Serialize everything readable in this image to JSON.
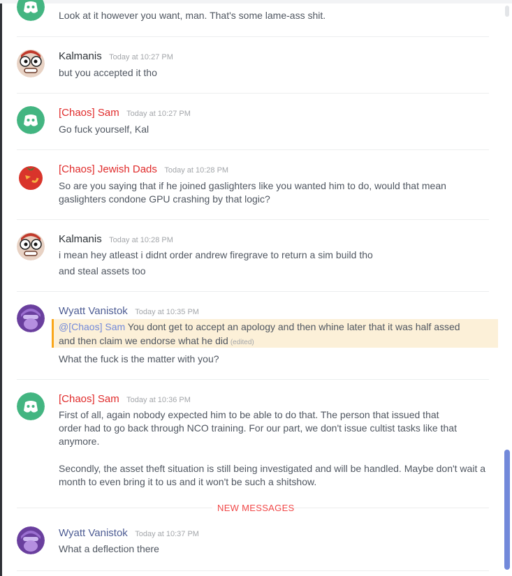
{
  "channel": {
    "messages": [
      {
        "author": "",
        "timestamp": "",
        "avatar": "discord-default-green",
        "lines": [
          "Look at it however you want, man. That's some lame-ass shit."
        ]
      },
      {
        "author": "Kalmanis",
        "timestamp": "Today at 10:27 PM",
        "avatar": "googly-eyes-face",
        "lines": [
          "but you accepted it tho"
        ]
      },
      {
        "author": "[Chaos] Sam",
        "timestamp": "Today at 10:27 PM",
        "avatar": "discord-default-green",
        "lines": [
          "Go fuck yourself, Kal"
        ]
      },
      {
        "author": "[Chaos] Jewish Dads",
        "timestamp": "Today at 10:28 PM",
        "avatar": "red-tomato-face",
        "lines": [
          "So are you saying that if he joined gaslighters like you wanted him to do, would that mean",
          "gaslighters condone GPU crashing by that logic?"
        ]
      },
      {
        "author": "Kalmanis",
        "timestamp": "Today at 10:28 PM",
        "avatar": "googly-eyes-face",
        "lines": [
          "i mean hey atleast i didnt order andrew firegrave to return a sim build tho",
          "and steal assets too"
        ]
      },
      {
        "author": "Wyatt Vanistok",
        "timestamp": "Today at 10:35 PM",
        "avatar": "purple-soldier",
        "mention": "@[Chaos] Sam",
        "mention_lines": [
          " You dont get to accept an apology and then whine later that it was half assed",
          "and then claim we endorse what he did"
        ],
        "edited": "(edited)",
        "lines": [
          "What the fuck is the matter with you?"
        ]
      },
      {
        "author": "[Chaos] Sam",
        "timestamp": "Today at 10:36 PM",
        "avatar": "discord-default-green",
        "lines": [
          "First of all, again nobody expected him to be able to do that. The person that issued that",
          "order had to go back through NCO training. For our part, we don't issue cultist tasks like that",
          "anymore.",
          "Secondly, the asset theft situation is still being investigated and will be handled. Maybe don't wait a",
          "month to even bring it to us and it won't be such a shitshow."
        ]
      },
      {
        "author": "Wyatt Vanistok",
        "timestamp": "Today at 10:37 PM",
        "avatar": "purple-soldier",
        "lines": [
          "What a deflection there"
        ]
      }
    ],
    "new_messages_label": "NEW MESSAGES"
  },
  "colors": {
    "role_chaos": "#e02b2b",
    "role_default": "#2e3338",
    "role_blue": "#4e5d94",
    "mention_bg": "#fcf0d8",
    "mention_bar": "#faa61a",
    "new_messages": "#f04747",
    "scrollbar": "#7289da"
  }
}
